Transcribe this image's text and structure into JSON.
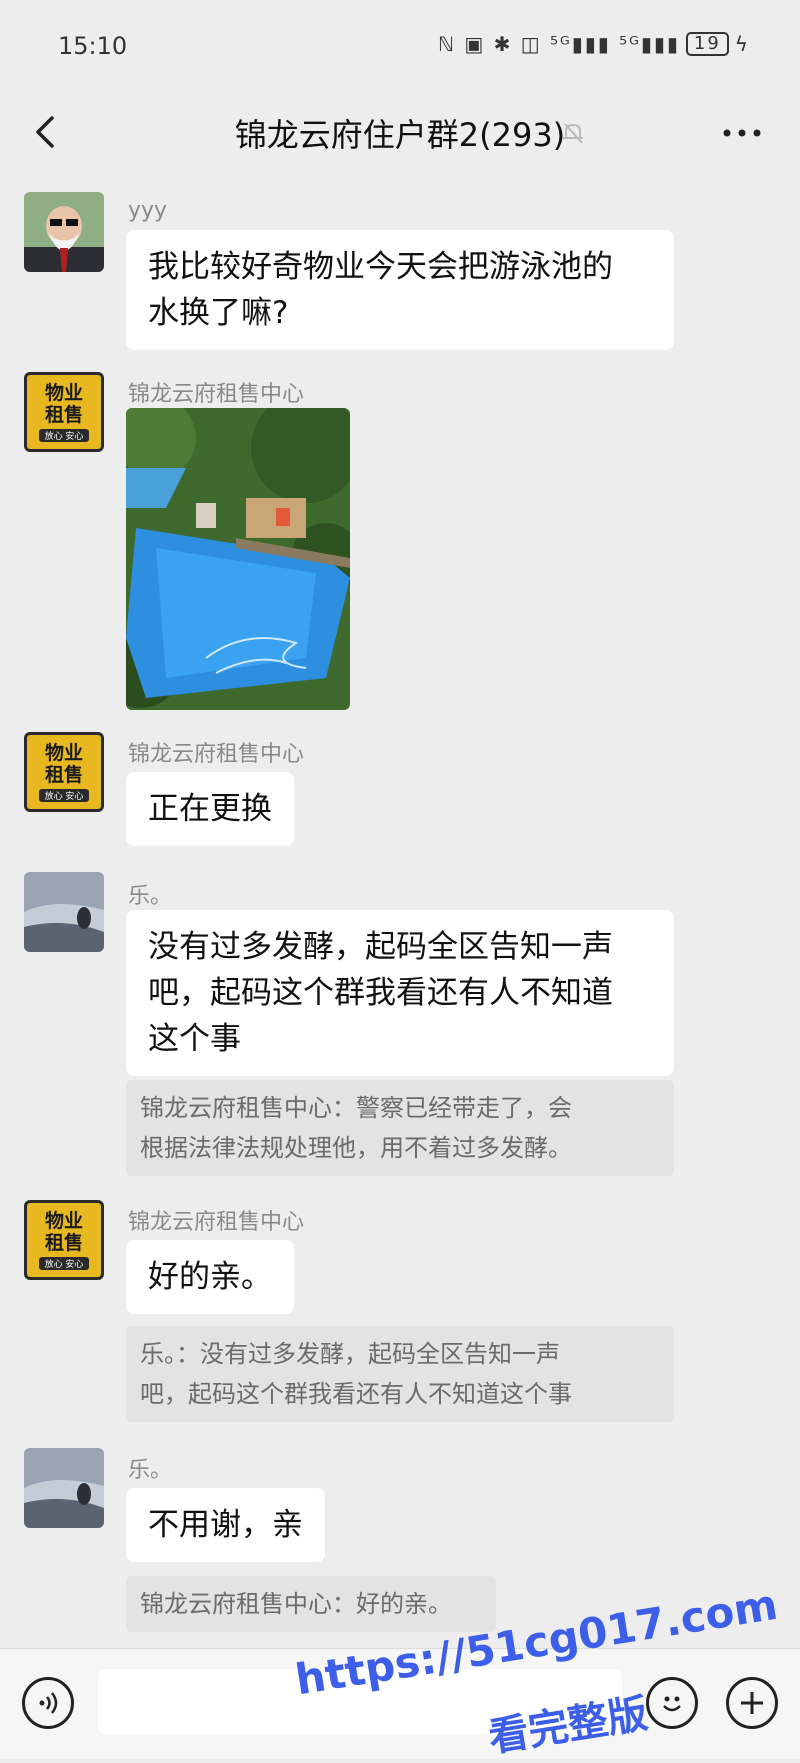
{
  "status_bar": {
    "time": "15:10",
    "signal_text": "ℕ ▣ ✱ ◫ ⁵ᴳ▮▮▮ ⁵ᴳ▮▮▮",
    "battery": "19",
    "charging": "ϟ"
  },
  "header": {
    "title": "锦龙云府住户群2(293)"
  },
  "messages": [
    {
      "sender": "yyy",
      "avatar": "old-man-avatar",
      "text_lines": [
        "我比较好奇物业今天会把游泳池的",
        "水换了嘛?"
      ]
    },
    {
      "sender": "锦龙云府租售中心",
      "avatar": "wuye-zushou-avatar",
      "image": "swimming-pool-photo"
    },
    {
      "sender": "锦龙云府租售中心",
      "avatar": "wuye-zushou-avatar",
      "text_lines": [
        "正在更换"
      ]
    },
    {
      "sender": "乐。",
      "avatar": "landscape-avatar",
      "text_lines": [
        "没有过多发酵，起码全区告知一声",
        "吧，起码这个群我看还有人不知道",
        "这个事"
      ],
      "quote_lines": [
        "锦龙云府租售中心：警察已经带走了，会",
        "根据法律法规处理他，用不着过多发酵。"
      ]
    },
    {
      "sender": "锦龙云府租售中心",
      "avatar": "wuye-zushou-avatar",
      "text_lines": [
        "好的亲。"
      ],
      "quote_lines": [
        "乐。：没有过多发酵，起码全区告知一声",
        "吧，起码这个群我看还有人不知道这个事"
      ]
    },
    {
      "sender": "乐。",
      "avatar": "landscape-avatar",
      "text_lines": [
        "不用谢，亲"
      ],
      "quote_lines": [
        "锦龙云府租售中心：好的亲。"
      ]
    }
  ],
  "avatar_text": {
    "wuye_line1": "物业",
    "wuye_line2": "租售",
    "wuye_sub": "放心 安心"
  },
  "watermark": {
    "line1": "https://51cg017.com",
    "line2": "看完整版"
  },
  "colors": {
    "background": "#ededed",
    "bubble": "#ffffff",
    "quote": "#e3e3e3",
    "watermark": "#3c5ee8",
    "avatar_wuye": "#e8b820"
  }
}
